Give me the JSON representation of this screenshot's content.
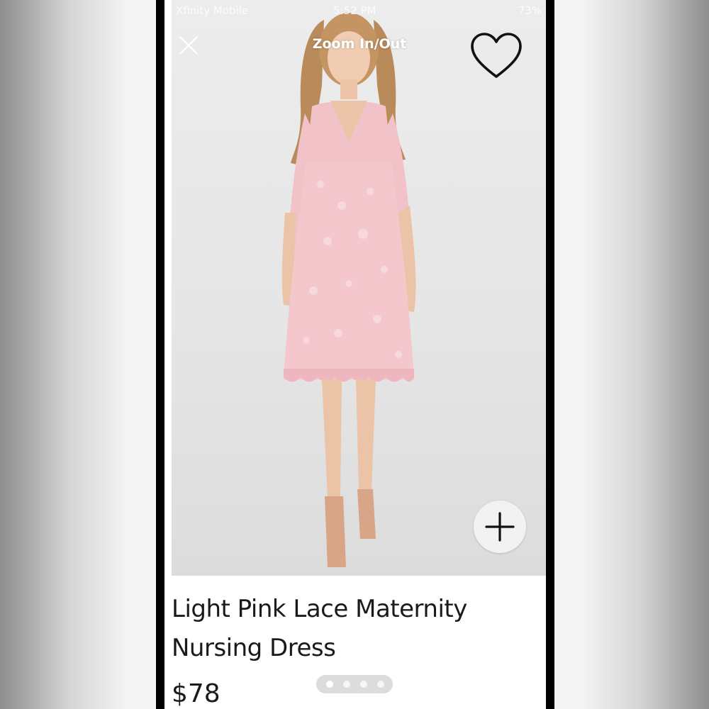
{
  "status_bar": {
    "carrier": "Xfinity Mobile",
    "time": "5:52 PM",
    "battery": "73%"
  },
  "header": {
    "zoom_label": "Zoom In/Out"
  },
  "icons": {
    "close": "close-icon",
    "favorite": "heart-icon",
    "add": "plus-icon"
  },
  "product": {
    "title_line1": "Light Pink Lace Maternity",
    "title_line2": "Nursing Dress",
    "price": "$78"
  },
  "gallery": {
    "image_count": 4,
    "active_index": 0
  },
  "colors": {
    "dress_pink": "#f2c2c9",
    "text": "#1a1a1a",
    "frame": "#000000"
  }
}
